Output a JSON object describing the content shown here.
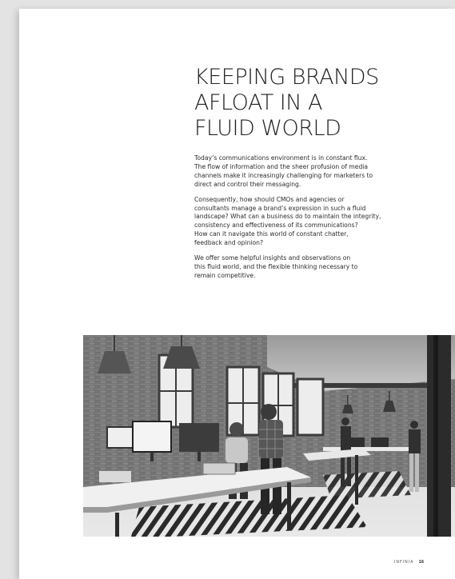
{
  "title_lines": [
    "KEEPING BRANDS",
    "AFLOAT IN A",
    "FLUID WORLD"
  ],
  "paragraphs": [
    [
      "Today’s communications environment is in constant flux.",
      "The flow of information and the sheer profusion of media",
      "channels make it increasingly challenging for marketers to",
      "direct and control their messaging."
    ],
    [
      "Consequently, how should CMOs and agencies or",
      "consultants manage a brand’s expression in such a fluid",
      "landscape? What can a business do to maintain the integrity,",
      "consistency and effectiveness of its communications?",
      "How can it navigate this world of constant chatter,",
      "feedback and opinion?"
    ],
    [
      "We offer some helpful insights and observations on",
      "this fluid world, and the flexible thinking necessary to",
      "remain competitive."
    ]
  ],
  "footer": {
    "brand": "INFINIA",
    "page_number": "16"
  },
  "colors": {
    "background": "#e3e3e3",
    "page": "#ffffff",
    "text": "#2b2b2b"
  }
}
